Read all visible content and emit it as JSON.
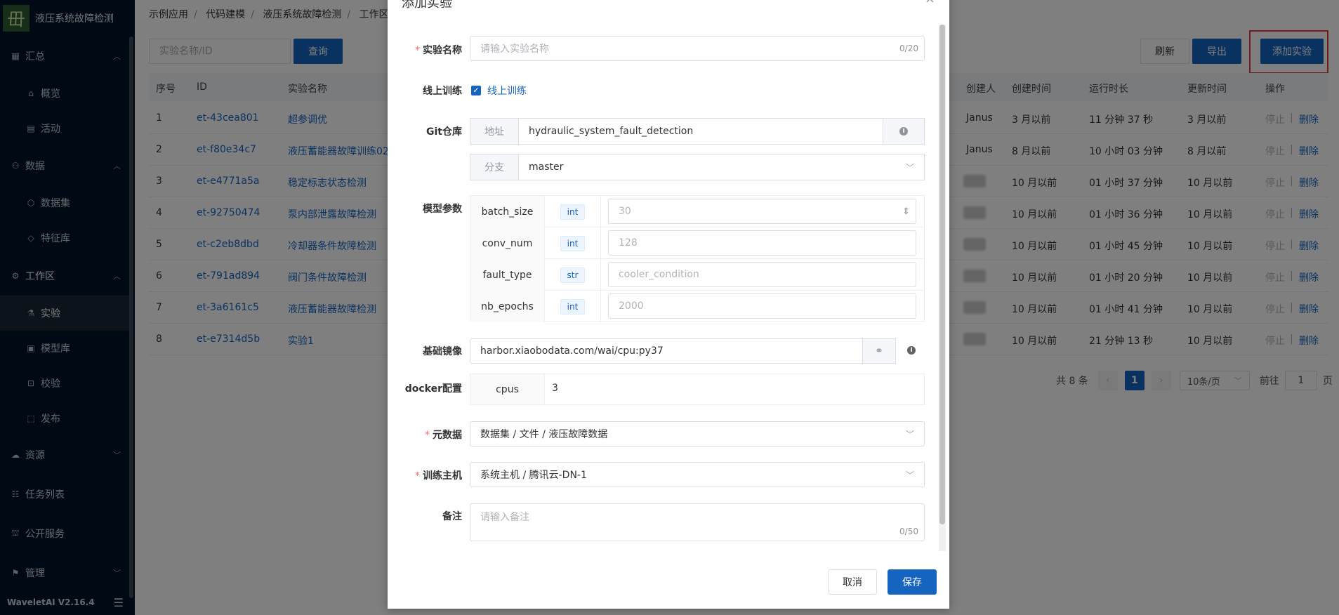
{
  "sidebar": {
    "app_name": "液压系统故障检测",
    "logo_glyph": "毌",
    "version": "WaveletAI V2.16.4",
    "items": [
      {
        "label": "汇总",
        "icon": "chart-icon",
        "glyph": "▦",
        "arrow": "︿"
      },
      {
        "label": "概览",
        "icon": "home-icon",
        "glyph": "⌂"
      },
      {
        "label": "活动",
        "icon": "calendar-icon",
        "glyph": "▤"
      },
      {
        "label": "数据",
        "icon": "network-icon",
        "glyph": "⚇",
        "arrow": "︿"
      },
      {
        "label": "数据集",
        "icon": "cube-icon",
        "glyph": "⬡"
      },
      {
        "label": "特征库",
        "icon": "diamond-icon",
        "glyph": "◇"
      },
      {
        "label": "工作区",
        "icon": "gear-icon",
        "glyph": "⚙",
        "arrow": "︿"
      },
      {
        "label": "实验",
        "icon": "flask-icon",
        "glyph": "⚗"
      },
      {
        "label": "模型库",
        "icon": "box-icon",
        "glyph": "▣"
      },
      {
        "label": "校验",
        "icon": "scan-icon",
        "glyph": "⊡"
      },
      {
        "label": "发布",
        "icon": "publish-icon",
        "glyph": "⬚"
      },
      {
        "label": "资源",
        "icon": "cloud-icon",
        "glyph": "☁",
        "arrow": "﹀"
      },
      {
        "label": "任务列表",
        "icon": "tasks-icon",
        "glyph": "☷"
      },
      {
        "label": "公开服务",
        "icon": "service-icon",
        "glyph": "⛫"
      },
      {
        "label": "管理",
        "icon": "manage-icon",
        "glyph": "⚑",
        "arrow": "﹀"
      }
    ],
    "fold_glyph": "☰"
  },
  "breadcrumb": [
    "示例应用",
    "代码建模",
    "液压系统故障检测",
    "工作区"
  ],
  "toolbar": {
    "search_placeholder": "实验名称/ID",
    "query_label": "查询",
    "refresh_label": "刷新",
    "export_label": "导出",
    "add_label": "添加实验"
  },
  "table": {
    "headers": [
      "序号",
      "ID",
      "实验名称",
      "创建人",
      "创建时间",
      "运行时长",
      "更新时间",
      "操作"
    ],
    "rows": [
      {
        "no": "1",
        "id": "et-43cea801",
        "name": "超参调优",
        "creator": "Janus",
        "created": "3 月以前",
        "duration": "11 分钟 37 秒",
        "updated": "3 月以前"
      },
      {
        "no": "2",
        "id": "et-f80e34c7",
        "name": "液压蓄能器故障训练02",
        "creator": "Janus",
        "created": "8 月以前",
        "duration": "10 小时 03 分钟",
        "updated": "8 月以前"
      },
      {
        "no": "3",
        "id": "et-e4771a5a",
        "name": "稳定标志状态检测",
        "creator": "",
        "created": "10 月以前",
        "duration": "01 小时 37 分钟",
        "updated": "10 月以前"
      },
      {
        "no": "4",
        "id": "et-92750474",
        "name": "泵内部泄露故障检测",
        "creator": "",
        "created": "10 月以前",
        "duration": "01 小时 36 分钟",
        "updated": "10 月以前"
      },
      {
        "no": "5",
        "id": "et-c2eb8dbd",
        "name": "冷却器条件故障检测",
        "creator": "",
        "created": "10 月以前",
        "duration": "01 小时 45 分钟",
        "updated": "10 月以前"
      },
      {
        "no": "6",
        "id": "et-791ad894",
        "name": "阀门条件故障检测",
        "creator": "",
        "created": "10 月以前",
        "duration": "01 小时 20 分钟",
        "updated": "10 月以前"
      },
      {
        "no": "7",
        "id": "et-3a6161c5",
        "name": "液压蓄能器故障检测",
        "creator": "",
        "created": "10 月以前",
        "duration": "01 小时 41 分钟",
        "updated": "10 月以前"
      },
      {
        "no": "8",
        "id": "et-e7314d5b",
        "name": "实验1",
        "creator": "",
        "created": "10 月以前",
        "duration": "21 分钟 13 秒",
        "updated": "10 月以前"
      }
    ],
    "action_stop": "停止",
    "action_sep": "|",
    "action_delete": "删除"
  },
  "pager": {
    "total": "共 8 条",
    "prev": "‹",
    "page": "1",
    "next": "›",
    "size": "10条/页",
    "goto": "前往",
    "goto_value": "1",
    "page_unit": "页"
  },
  "dialog": {
    "title": "添加实验",
    "close_glyph": "×",
    "name": {
      "label": "实验名称",
      "placeholder": "请输入实验名称",
      "counter": "0/20"
    },
    "online": {
      "label": "线上训练",
      "checkbox_label": "线上训练",
      "checked": true
    },
    "git": {
      "label": "Git仓库",
      "addr_prefix": "地址",
      "addr_value": "hydraulic_system_fault_detection",
      "branch_prefix": "分支",
      "branch_value": "master"
    },
    "params": {
      "label": "模型参数",
      "rows": [
        {
          "name": "batch_size",
          "type": "int",
          "placeholder": "30"
        },
        {
          "name": "conv_num",
          "type": "int",
          "placeholder": "128"
        },
        {
          "name": "fault_type",
          "type": "str",
          "placeholder": "cooler_condition"
        },
        {
          "name": "nb_epochs",
          "type": "int",
          "placeholder": "2000"
        }
      ]
    },
    "image": {
      "label": "基础镜像",
      "value": "harbor.xiaobodata.com/wai/cpu:py37"
    },
    "docker": {
      "label": "docker配置",
      "key": "cpus",
      "value": "3"
    },
    "metadata": {
      "label": "元数据",
      "value": "数据集 / 文件 / 液压故障数据"
    },
    "host": {
      "label": "训练主机",
      "value": "系统主机 / 腾讯云-DN-1"
    },
    "note": {
      "label": "备注",
      "placeholder": "请输入备注",
      "counter": "0/50"
    },
    "cancel_label": "取消",
    "save_label": "保存"
  },
  "colors": {
    "primary": "#1564c0",
    "sidebar": "#001529",
    "highlight": "#e53935"
  }
}
